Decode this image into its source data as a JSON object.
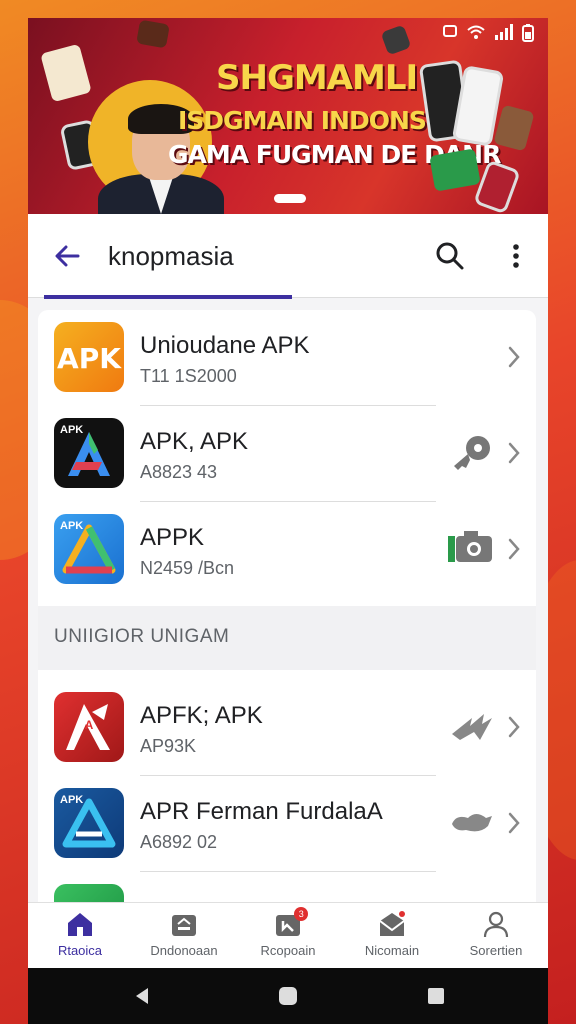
{
  "colors": {
    "accent": "#3d2fa0",
    "banner": "#c8202c",
    "banner_title": "#f8d64a"
  },
  "banner": {
    "title_line1": "SHGMAMLI",
    "title_line2": "ISDGMAIN INDONSIAI",
    "title_line3": "GAMA FUGMAN DE DANR"
  },
  "search": {
    "query": "knopmasia",
    "back_icon": "arrow-left-icon",
    "search_icon": "search-icon",
    "more_icon": "more-vert-icon"
  },
  "apps": [
    {
      "name": "Unioudane APK",
      "sub": "T11 1S2000",
      "icon_label": "APK"
    },
    {
      "name": "APK, APK",
      "sub": "A8823 43",
      "icon_label": "APK"
    },
    {
      "name": "APPK",
      "sub": "N2459 /Bcn",
      "icon_label": "APK"
    }
  ],
  "section": {
    "label": "UNIIGIOR UNIGAM"
  },
  "apps2": [
    {
      "name": "APFK; APK",
      "sub": "AP93K",
      "icon_label": "A"
    },
    {
      "name": "APR Ferman FurdalaA",
      "sub": "A6892 02",
      "icon_label": "APK"
    }
  ],
  "nav": [
    {
      "label": "Rtaoica",
      "icon": "home-icon",
      "active": true
    },
    {
      "label": "Dndonoaan",
      "icon": "store-icon",
      "active": false
    },
    {
      "label": "Rcopoain",
      "icon": "updates-icon",
      "active": false,
      "badge": "3"
    },
    {
      "label": "Nicomain",
      "icon": "mail-icon",
      "active": false
    },
    {
      "label": "Sorertien",
      "icon": "profile-icon",
      "active": false
    }
  ]
}
